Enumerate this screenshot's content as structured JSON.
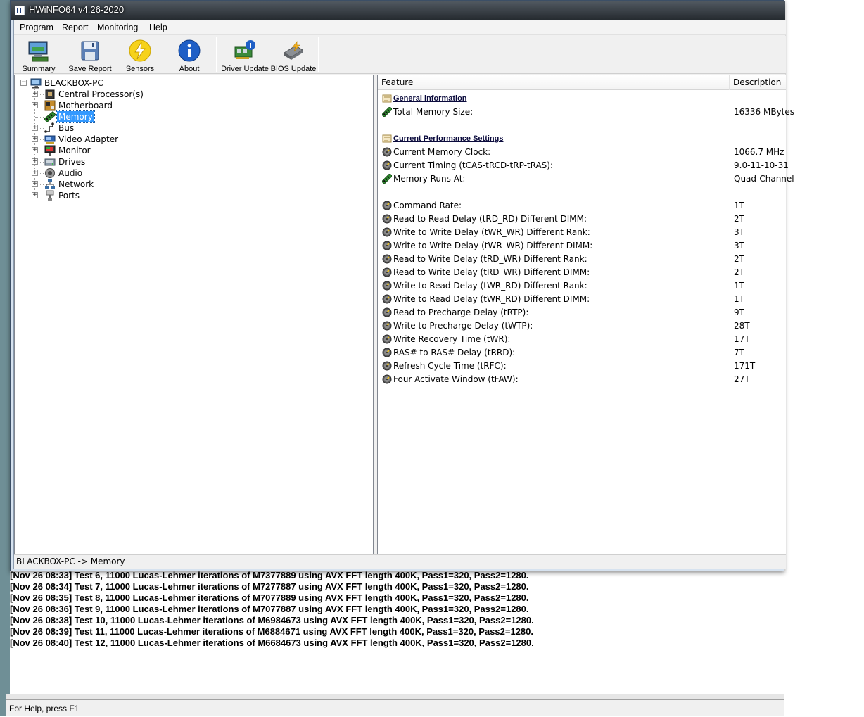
{
  "window": {
    "title": "HWiNFO64 v4.26-2020"
  },
  "menu": [
    "Program",
    "Report",
    "Monitoring",
    "Help"
  ],
  "toolbar": [
    {
      "label": "Summary",
      "icon": "summary-icon"
    },
    {
      "label": "Save Report",
      "icon": "save-report-icon"
    },
    {
      "label": "Sensors",
      "icon": "sensors-icon"
    },
    {
      "label": "About",
      "icon": "about-icon"
    },
    {
      "label": "Driver Update",
      "icon": "driver-update-icon"
    },
    {
      "label": "BIOS Update",
      "icon": "bios-update-icon"
    }
  ],
  "tree": {
    "root": "BLACKBOX-PC",
    "items": [
      {
        "label": "Central Processor(s)",
        "icon": "cpu-icon",
        "expandable": true
      },
      {
        "label": "Motherboard",
        "icon": "motherboard-icon",
        "expandable": true
      },
      {
        "label": "Memory",
        "icon": "memory-icon",
        "expandable": false,
        "selected": true
      },
      {
        "label": "Bus",
        "icon": "bus-icon",
        "expandable": true
      },
      {
        "label": "Video Adapter",
        "icon": "video-adapter-icon",
        "expandable": true
      },
      {
        "label": "Monitor",
        "icon": "monitor-icon",
        "expandable": true
      },
      {
        "label": "Drives",
        "icon": "drives-icon",
        "expandable": true
      },
      {
        "label": "Audio",
        "icon": "audio-icon",
        "expandable": true
      },
      {
        "label": "Network",
        "icon": "network-icon",
        "expandable": true
      },
      {
        "label": "Ports",
        "icon": "ports-icon",
        "expandable": true
      }
    ]
  },
  "details": {
    "headers": {
      "feature": "Feature",
      "description": "Description"
    },
    "rows": [
      {
        "type": "section",
        "feature": "General information",
        "icon": "info-section-icon"
      },
      {
        "type": "item",
        "feature": "Total Memory Size:",
        "value": "16336 MBytes",
        "icon": "memory-stick-icon"
      },
      {
        "type": "blank"
      },
      {
        "type": "section",
        "feature": "Current Performance Settings",
        "icon": "info-section-icon"
      },
      {
        "type": "item",
        "feature": "Current Memory Clock:",
        "value": "1066.7 MHz",
        "icon": "gauge-icon"
      },
      {
        "type": "item",
        "feature": "Current Timing (tCAS-tRCD-tRP-tRAS):",
        "value": "9.0-11-10-31",
        "icon": "gauge-icon"
      },
      {
        "type": "item",
        "feature": "Memory Runs At:",
        "value": "Quad-Channel",
        "icon": "memory-stick-icon"
      },
      {
        "type": "blank"
      },
      {
        "type": "item",
        "feature": "Command Rate:",
        "value": "1T",
        "icon": "gauge-icon"
      },
      {
        "type": "item",
        "feature": "Read to Read Delay (tRD_RD) Different DIMM:",
        "value": "2T",
        "icon": "gauge-icon"
      },
      {
        "type": "item",
        "feature": "Write to Write Delay (tWR_WR) Different Rank:",
        "value": "3T",
        "icon": "gauge-icon"
      },
      {
        "type": "item",
        "feature": "Write to Write Delay (tWR_WR) Different DIMM:",
        "value": "3T",
        "icon": "gauge-icon"
      },
      {
        "type": "item",
        "feature": "Read to Write Delay (tRD_WR) Different Rank:",
        "value": "2T",
        "icon": "gauge-icon"
      },
      {
        "type": "item",
        "feature": "Read to Write Delay (tRD_WR) Different DIMM:",
        "value": "2T",
        "icon": "gauge-icon"
      },
      {
        "type": "item",
        "feature": "Write to Read Delay (tWR_RD) Different Rank:",
        "value": "1T",
        "icon": "gauge-icon"
      },
      {
        "type": "item",
        "feature": "Write to Read Delay (tWR_RD) Different DIMM:",
        "value": "1T",
        "icon": "gauge-icon"
      },
      {
        "type": "item",
        "feature": "Read to Precharge Delay (tRTP):",
        "value": "9T",
        "icon": "gauge-icon"
      },
      {
        "type": "item",
        "feature": "Write to Precharge Delay (tWTP):",
        "value": "28T",
        "icon": "gauge-icon"
      },
      {
        "type": "item",
        "feature": "Write Recovery Time (tWR):",
        "value": "17T",
        "icon": "gauge-icon"
      },
      {
        "type": "item",
        "feature": "RAS# to RAS# Delay (tRRD):",
        "value": "7T",
        "icon": "gauge-icon"
      },
      {
        "type": "item",
        "feature": "Refresh Cycle Time (tRFC):",
        "value": "171T",
        "icon": "gauge-icon"
      },
      {
        "type": "item",
        "feature": "Four Activate Window (tFAW):",
        "value": "27T",
        "icon": "gauge-icon"
      }
    ]
  },
  "status": {
    "path": "BLACKBOX-PC -> Memory"
  },
  "console": {
    "lines": [
      "[Nov 26 08:33] Test 6, 11000 Lucas-Lehmer iterations of M7377889 using AVX FFT length 400K, Pass1=320, Pass2=1280.",
      "[Nov 26 08:34] Test 7, 11000 Lucas-Lehmer iterations of M7277887 using AVX FFT length 400K, Pass1=320, Pass2=1280.",
      "[Nov 26 08:35] Test 8, 11000 Lucas-Lehmer iterations of M7077889 using AVX FFT length 400K, Pass1=320, Pass2=1280.",
      "[Nov 26 08:36] Test 9, 11000 Lucas-Lehmer iterations of M7077887 using AVX FFT length 400K, Pass1=320, Pass2=1280.",
      "[Nov 26 08:38] Test 10, 11000 Lucas-Lehmer iterations of M6984673 using AVX FFT length 400K, Pass1=320, Pass2=1280.",
      "[Nov 26 08:39] Test 11, 11000 Lucas-Lehmer iterations of M6884671 using AVX FFT length 400K, Pass1=320, Pass2=1280.",
      "[Nov 26 08:40] Test 12, 11000 Lucas-Lehmer iterations of M6684673 using AVX FFT length 400K, Pass1=320, Pass2=1280."
    ],
    "status_text": "For Help, press F1"
  }
}
